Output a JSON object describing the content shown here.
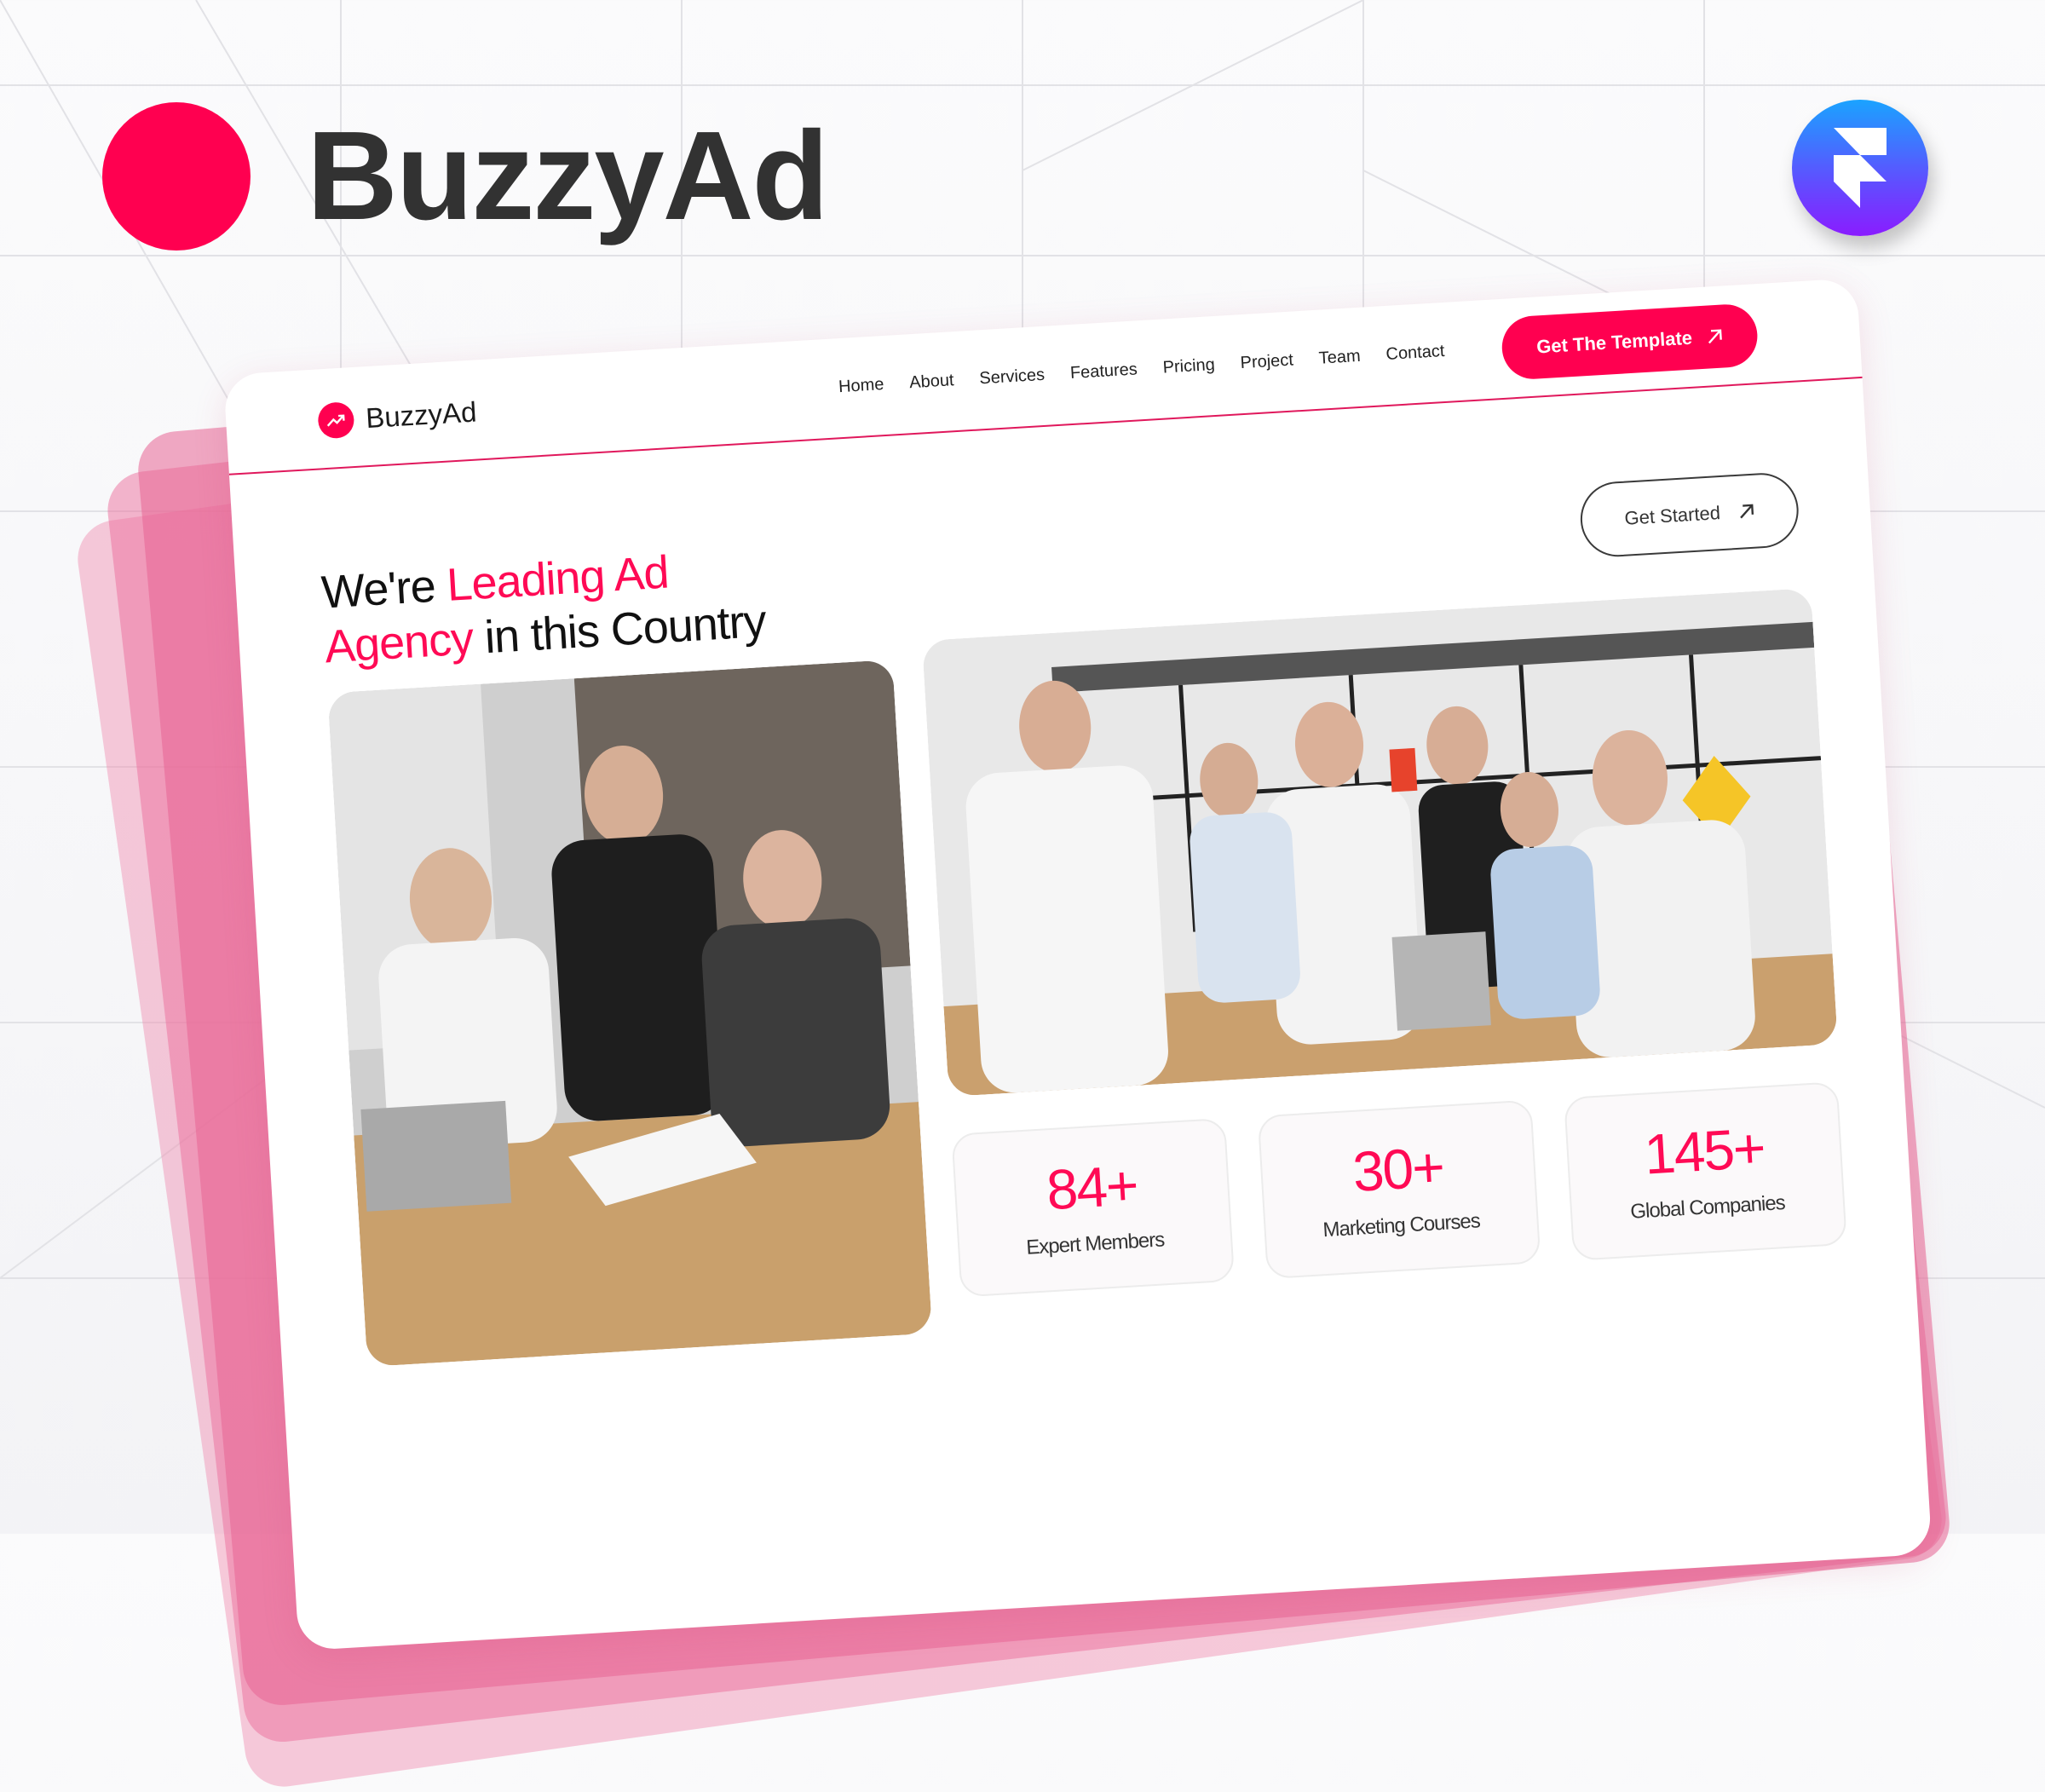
{
  "brand": {
    "name": "BuzzyAd",
    "dot_color": "#ff0050"
  },
  "framer_badge": {
    "icon": "framer-logo-icon"
  },
  "website": {
    "logo": {
      "text": "BuzzyAd",
      "icon": "trending-up-icon"
    },
    "nav": {
      "items": [
        {
          "label": "Home"
        },
        {
          "label": "About"
        },
        {
          "label": "Services"
        },
        {
          "label": "Features"
        },
        {
          "label": "Pricing"
        },
        {
          "label": "Project"
        },
        {
          "label": "Team"
        },
        {
          "label": "Contact"
        }
      ],
      "cta_label": "Get The Template",
      "cta_icon": "arrow-up-right-icon"
    },
    "hero": {
      "title_part1": "We're ",
      "title_highlight1": "Leading Ad",
      "title_highlight2": "Agency",
      "title_part2": " in this Country",
      "get_started_label": "Get Started",
      "get_started_icon": "arrow-up-right-icon"
    },
    "images": [
      {
        "alt": "Team meeting at table with laptop and documents"
      },
      {
        "alt": "Excited team celebrating in office"
      }
    ],
    "stats": [
      {
        "value": "84+",
        "label": "Expert Members"
      },
      {
        "value": "30+",
        "label": "Marketing Courses"
      },
      {
        "value": "145+",
        "label": "Global Companies"
      }
    ]
  },
  "colors": {
    "accent": "#ff0050",
    "text_dark": "#323232",
    "framer_gradient_top": "#1aa3ff",
    "framer_gradient_bottom": "#8a1cff"
  }
}
